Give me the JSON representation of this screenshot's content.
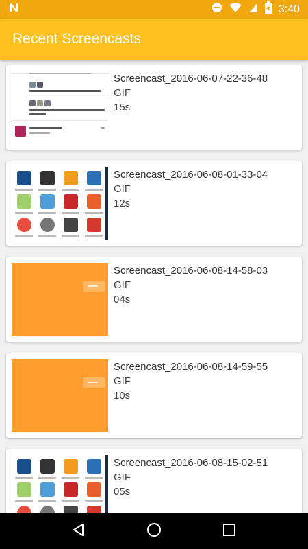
{
  "status_bar": {
    "time": "3:40",
    "icons": [
      "n-logo-icon",
      "do-not-disturb-icon",
      "wifi-icon",
      "signal-icon",
      "battery-charging-icon"
    ]
  },
  "app_bar": {
    "title": "Recent Screencasts",
    "color": "#ffc022"
  },
  "screencasts": [
    {
      "name": "Screencast_2016-06-07-22-36-48",
      "type": "GIF",
      "duration": "15s",
      "thumbnail": "tweet-list"
    },
    {
      "name": "Screencast_2016-06-08-01-33-04",
      "type": "GIF",
      "duration": "12s",
      "thumbnail": "app-grid"
    },
    {
      "name": "Screencast_2016-06-08-14-58-03",
      "type": "GIF",
      "duration": "04s",
      "thumbnail": "orange"
    },
    {
      "name": "Screencast_2016-06-08-14-59-55",
      "type": "GIF",
      "duration": "10s",
      "thumbnail": "orange"
    },
    {
      "name": "Screencast_2016-06-08-15-02-51",
      "type": "GIF",
      "duration": "05s",
      "thumbnail": "app-grid"
    }
  ],
  "nav_bar": {
    "buttons": [
      "back-icon",
      "home-icon",
      "recents-icon"
    ]
  }
}
